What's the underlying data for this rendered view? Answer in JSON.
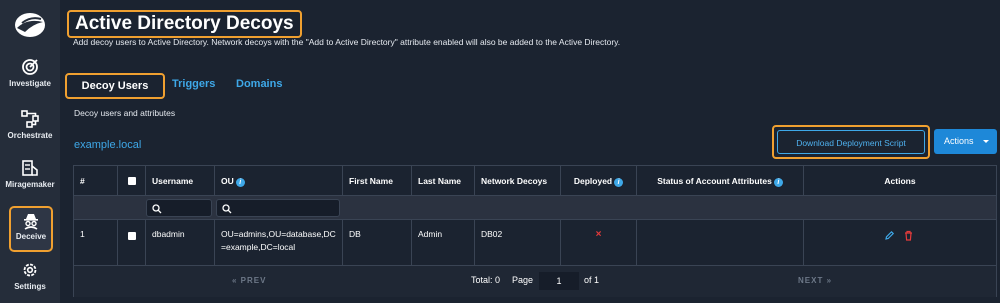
{
  "sidebar": {
    "items": [
      {
        "label": "Investigate",
        "icon": "target-icon"
      },
      {
        "label": "Orchestrate",
        "icon": "workflow-icon"
      },
      {
        "label": "Miragemaker",
        "icon": "layers-icon"
      },
      {
        "label": "Deceive",
        "icon": "spy-icon"
      },
      {
        "label": "Settings",
        "icon": "gear-icon"
      }
    ]
  },
  "header": {
    "title": "Active Directory Decoys",
    "subtitle": "Add decoy users to Active Directory. Network decoys with the \"Add to Active Directory\" attribute enabled will also be added to the Active Directory."
  },
  "tabs": [
    "Decoy Users",
    "Triggers",
    "Domains"
  ],
  "section": {
    "description": "Decoy users and attributes",
    "domain": "example.local",
    "download_label": "Download Deployment Script",
    "actions_label": "Actions"
  },
  "table": {
    "columns": [
      "#",
      "",
      "Username",
      "OU",
      "First Name",
      "Last Name",
      "Network Decoys",
      "Deployed",
      "Status of Account Attributes",
      "Actions"
    ],
    "rows": [
      {
        "num": "1",
        "username": "dbadmin",
        "ou": "OU=admins,OU=database,DC=example,DC=local",
        "first_name": "DB",
        "last_name": "Admin",
        "network_decoys": "DB02",
        "deployed": "×",
        "status": ""
      }
    ]
  },
  "pagination": {
    "prev": "PREV",
    "next": "NEXT",
    "total_label": "Total: 0",
    "page_label": "Page",
    "page_value": "1",
    "of_label": "of 1"
  },
  "colors": {
    "accent": "#3ea8e8",
    "highlight": "#f0a030",
    "danger": "#e63b3b",
    "background": "#1b2330"
  }
}
